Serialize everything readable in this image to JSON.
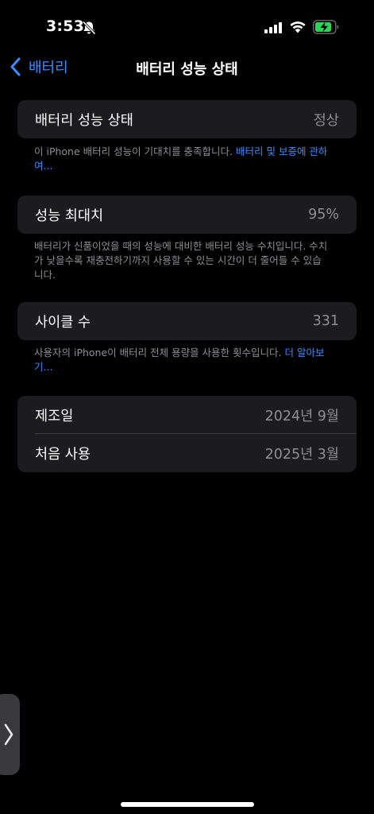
{
  "status_bar": {
    "time": "3:53",
    "icons": [
      "bell-slash-icon",
      "signal-icon",
      "wifi-icon",
      "battery-charging-icon"
    ]
  },
  "nav": {
    "back_label": "배터리",
    "title": "배터리 성능 상태"
  },
  "health": {
    "label": "배터리 성능 상태",
    "value": "정상",
    "footnote_text": "이 iPhone 배터리 성능이 기대치를 충족합니다. ",
    "footnote_link": "배터리 및 보증에 관하여..."
  },
  "max_capacity": {
    "label": "성능 최대치",
    "value": "95%",
    "footnote_text": "배터리가 신품이었을 때의 성능에 대비한 배터리 성능 수치입니다. 수치가 낮을수록 재충전하기까지 사용할 수 있는 시간이 더 줄어들 수 있습니다."
  },
  "cycle_count": {
    "label": "사이클 수",
    "value": "331",
    "footnote_text": "사용자의 iPhone이 배터리 전체 용량을 사용한 횟수입니다. ",
    "footnote_link": "더 알아보기..."
  },
  "dates": {
    "manufacture_label": "제조일",
    "manufacture_value": "2024년 9월",
    "first_use_label": "처음 사용",
    "first_use_value": "2025년 3월"
  },
  "colors": {
    "background": "#000000",
    "card": "#1c1c1e",
    "accent": "#3b8cff",
    "secondary_text": "#8e8e93",
    "battery_charging": "#30d158"
  }
}
